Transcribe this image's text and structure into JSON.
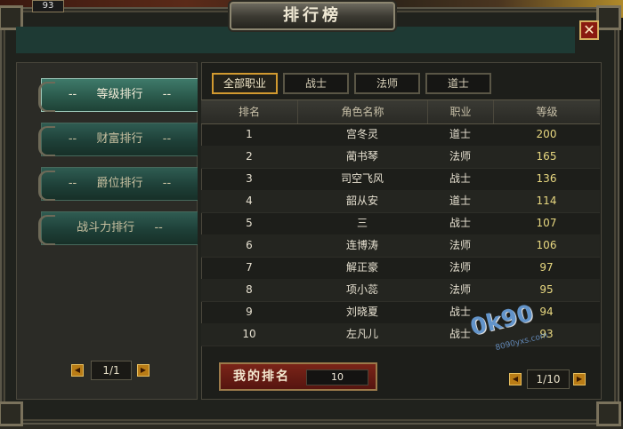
{
  "game_hud": {
    "level": "93"
  },
  "window": {
    "title": "排行榜",
    "close_label": "✕"
  },
  "categories": [
    {
      "label": "等级排行",
      "active": true
    },
    {
      "label": "财富排行",
      "active": false
    },
    {
      "label": "爵位排行",
      "active": false
    },
    {
      "label": "战斗力排行",
      "active": false
    }
  ],
  "category_dash": "--",
  "left_pager": {
    "prev": "◀",
    "value": "1/1",
    "next": "▶"
  },
  "tabs": [
    {
      "label": "全部职业",
      "active": true
    },
    {
      "label": "战士",
      "active": false
    },
    {
      "label": "法师",
      "active": false
    },
    {
      "label": "道士",
      "active": false
    }
  ],
  "table": {
    "headers": [
      "排名",
      "角色名称",
      "职业",
      "等级"
    ],
    "rows": [
      {
        "rank": "1",
        "name": "宫冬灵",
        "class": "道士",
        "level": "200"
      },
      {
        "rank": "2",
        "name": "蔺书琴",
        "class": "法师",
        "level": "165"
      },
      {
        "rank": "3",
        "name": "司空飞风",
        "class": "战士",
        "level": "136"
      },
      {
        "rank": "4",
        "name": "韶从安",
        "class": "道士",
        "level": "114"
      },
      {
        "rank": "5",
        "name": "三",
        "class": "战士",
        "level": "107"
      },
      {
        "rank": "6",
        "name": "连博涛",
        "class": "法师",
        "level": "106"
      },
      {
        "rank": "7",
        "name": "解正豪",
        "class": "法师",
        "level": "97"
      },
      {
        "rank": "8",
        "name": "项小蕊",
        "class": "法师",
        "level": "95"
      },
      {
        "rank": "9",
        "name": "刘晓夏",
        "class": "战士",
        "level": "94"
      },
      {
        "rank": "10",
        "name": "左凡儿",
        "class": "战士",
        "level": "93"
      }
    ]
  },
  "my_rank": {
    "label": "我的排名",
    "value": "10"
  },
  "right_pager": {
    "prev": "◀",
    "value": "1/10",
    "next": "▶"
  },
  "watermark": {
    "text": "0k90",
    "sub": "8090yxs.com"
  },
  "colors": {
    "active_tab_border": "#d29a30",
    "category_green": "#2b5a4c",
    "level_text": "#e8d880",
    "my_rank_red": "#7a2418"
  }
}
